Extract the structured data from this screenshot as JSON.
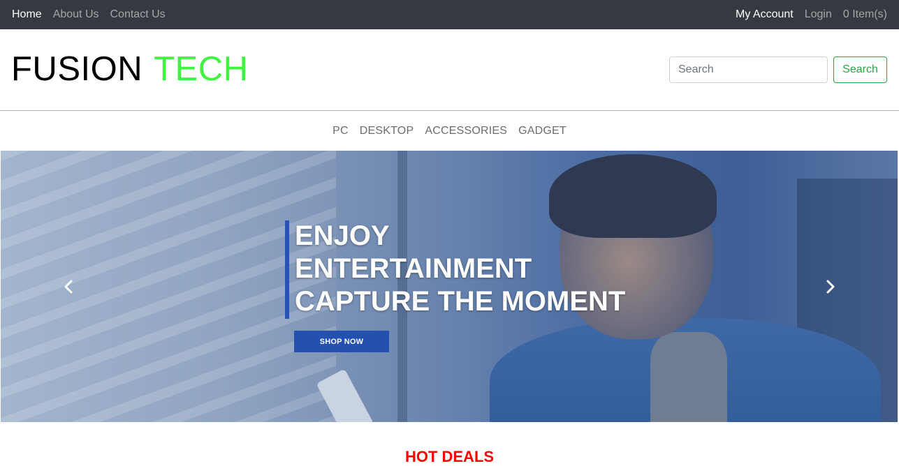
{
  "topbar": {
    "left_links": [
      "Home",
      "About Us",
      "Contact Us"
    ],
    "right_links": [
      "My Account",
      "Login",
      "0 Item(s)"
    ]
  },
  "brand": {
    "word1": "FUSION",
    "word2": "TECH",
    "accent_color": "#3ef43e"
  },
  "search": {
    "placeholder": "Search",
    "button_label": "Search"
  },
  "categories": [
    "PC",
    "DESKTOP",
    "ACCESSORIES",
    "GADGET"
  ],
  "hero": {
    "line1": "ENJOY",
    "line2": "ENTERTAINMENT",
    "line3": "CAPTURE THE MOMENT",
    "cta": "SHOP NOW",
    "prev_icon": "chevron-left-icon",
    "next_icon": "chevron-right-icon"
  },
  "section": {
    "hot_deals": "HOT DEALS"
  }
}
